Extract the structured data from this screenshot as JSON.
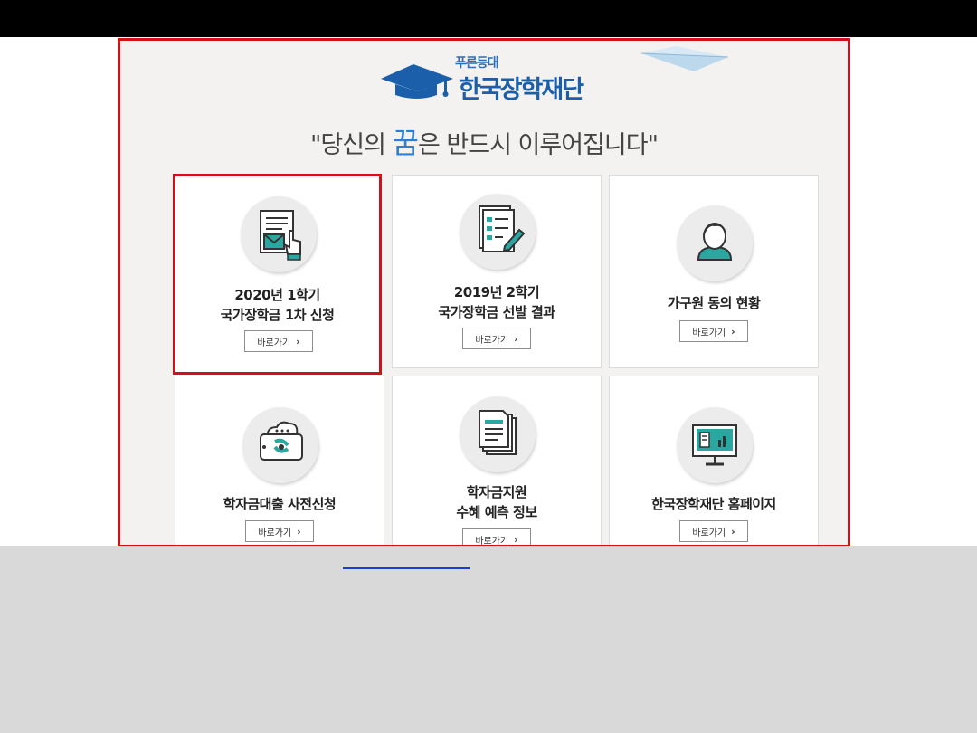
{
  "header": {
    "logo_small": "푸른등대",
    "logo_big": "한국장학재단",
    "slogan_before": "\"당신의 ",
    "slogan_emphasis": "꿈",
    "slogan_after": "은 반드시 이루어집니다\""
  },
  "cards": [
    {
      "line1": "2020년 1학기",
      "line2": "국가장학금 1차 신청",
      "button": "바로가기",
      "icon": "document-mail-hand-icon",
      "selected": true
    },
    {
      "line1": "2019년 2학기",
      "line2": "국가장학금 선발 결과",
      "button": "바로가기",
      "icon": "document-list-pen-icon",
      "selected": false
    },
    {
      "line1": "가구원 동의 현황",
      "line2": "",
      "button": "바로가기",
      "icon": "person-icon",
      "selected": false
    },
    {
      "line1": "학자금대출 사전신청",
      "line2": "",
      "button": "바로가기",
      "icon": "phone-cloud-icon",
      "selected": false
    },
    {
      "line1": "학자금지원",
      "line2": "수혜 예측 정보",
      "button": "바로가기",
      "icon": "stacked-papers-icon",
      "selected": false
    },
    {
      "line1": "한국장학재단 홈페이지",
      "line2": "",
      "button": "바로가기",
      "icon": "monitor-icon",
      "selected": false
    }
  ],
  "colors": {
    "frame_border": "#d0101a",
    "accent_blue": "#1b5faa",
    "icon_teal": "#2aa7a0"
  }
}
